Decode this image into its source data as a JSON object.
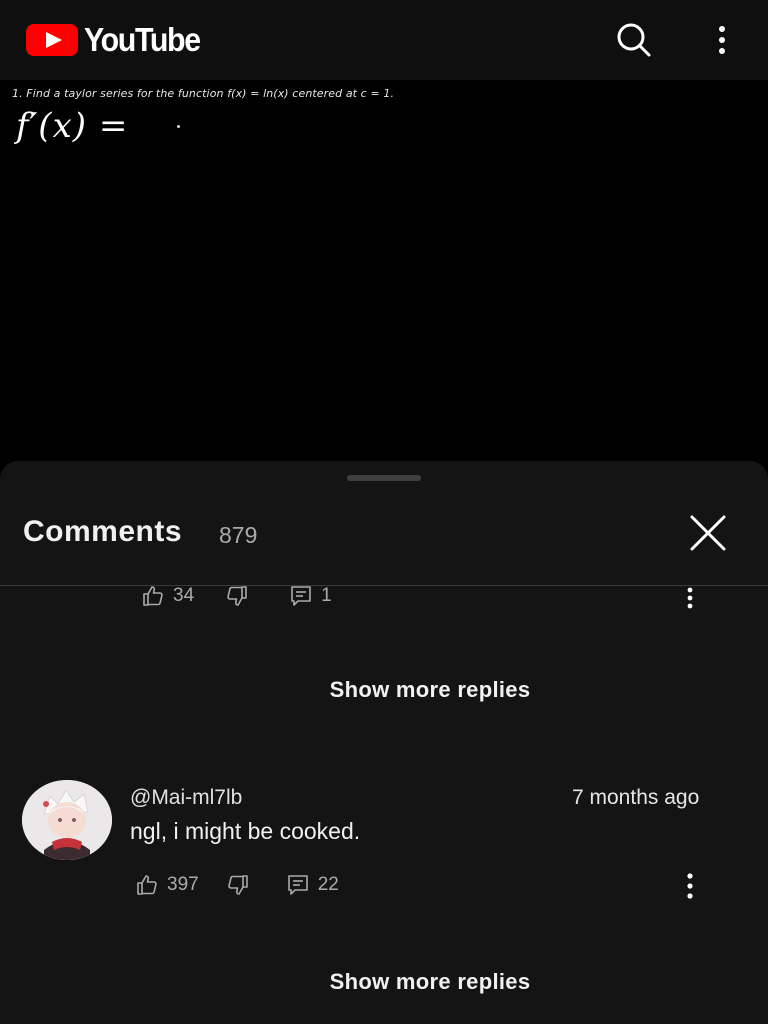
{
  "app": {
    "name": "YouTube"
  },
  "colors": {
    "brand_red": "#ff0000",
    "sheet_bg": "#141414",
    "topbar_bg": "#0f0f0f",
    "muted_text": "#aaaaaa"
  },
  "icons": {
    "logo": "youtube-play-icon",
    "search": "search-icon",
    "menu": "more-vert-icon",
    "close": "close-icon",
    "like": "thumbs-up-icon",
    "dislike": "thumbs-down-icon",
    "reply": "reply-icon",
    "comment_menu": "more-vert-icon"
  },
  "video": {
    "problem": "1.  Find a taylor series for the function f(x) = ln(x) centered at c = 1.",
    "handwriting": "f′(x) ="
  },
  "comments": {
    "title": "Comments",
    "count": "879",
    "partial_item": {
      "likes": "34",
      "replies": "1"
    },
    "show_more_label": "Show more replies",
    "items": [
      {
        "author": "@Mai-ml7lb",
        "time": "7 months ago",
        "text": "ngl, i might be cooked.",
        "likes": "397",
        "replies": "22"
      }
    ]
  }
}
